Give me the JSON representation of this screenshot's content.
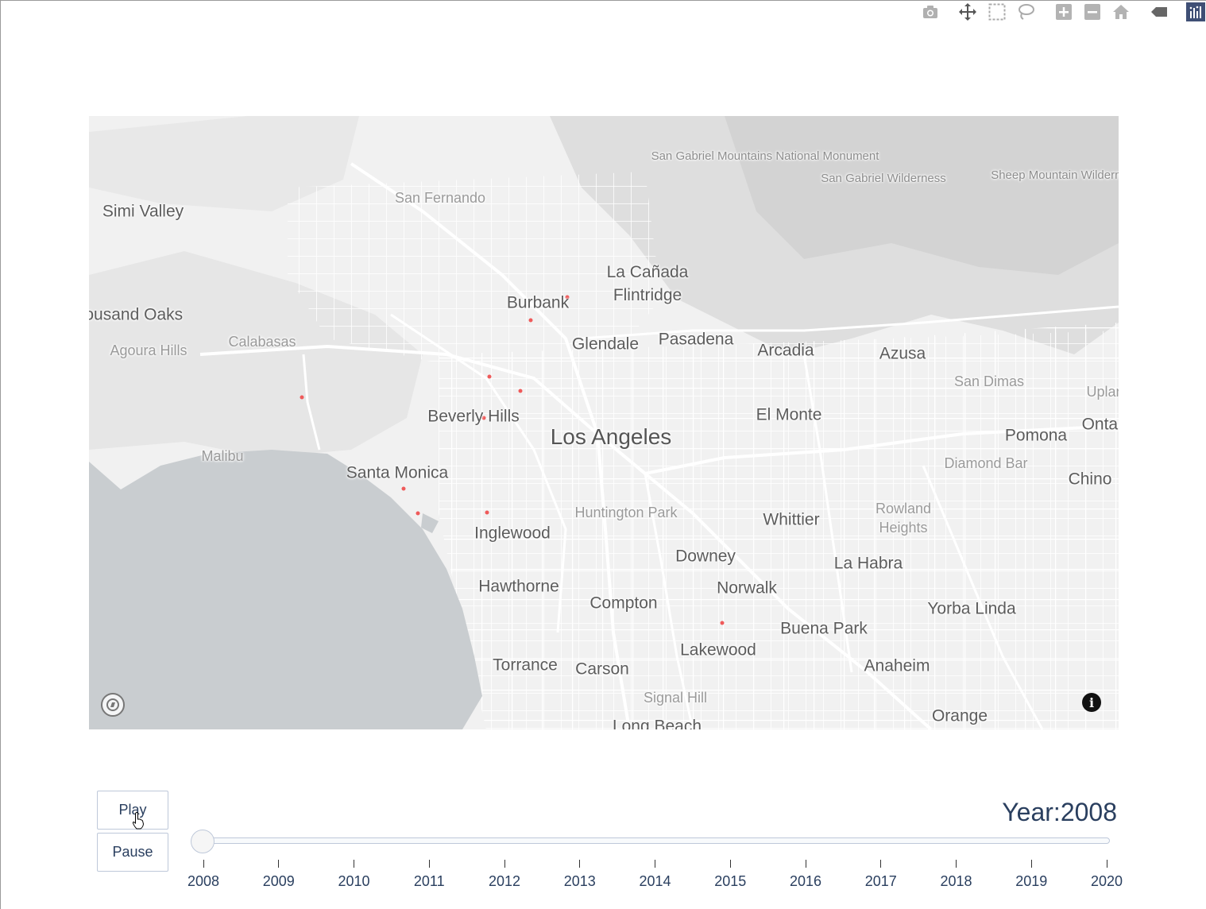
{
  "modebar": {
    "buttons": [
      "camera-icon",
      "pan-icon",
      "box-select-icon",
      "lasso-icon",
      "zoom-in-icon",
      "zoom-out-icon",
      "reset-home-icon",
      "tag-icon",
      "plotly-logo-icon"
    ]
  },
  "map": {
    "cities_large": [
      "Los Angeles"
    ],
    "cities": [
      "Simi Valley",
      "Thousand Oaks",
      "Burbank",
      "La Cañada Flintridge",
      "Glendale",
      "Pasadena",
      "Arcadia",
      "Azusa",
      "Beverly Hills",
      "El Monte",
      "Pomona",
      "Ontario",
      "Chino",
      "Santa Monica",
      "Inglewood",
      "Whittier",
      "Downey",
      "La Habra",
      "Hawthorne",
      "Norwalk",
      "Compton",
      "Yorba Linda",
      "Buena Park",
      "Lakewood",
      "Torrance",
      "Carson",
      "Anaheim",
      "Orange",
      "Long Beach"
    ],
    "minor": [
      "San Fernando",
      "Agoura Hills",
      "Calabasas",
      "San Dimas",
      "Upland",
      "Diamond Bar",
      "Malibu",
      "Huntington Park",
      "Rowland Heights",
      "Signal Hill"
    ],
    "parks": [
      "San Gabriel Mountains National Monument",
      "San Gabriel Wilderness",
      "Sheep Mountain Wilderness"
    ],
    "markers": 10,
    "info_icon": "info-icon",
    "logo_icon": "mapbox-logo-icon"
  },
  "controls": {
    "play_label": "Play",
    "pause_label": "Pause"
  },
  "slider": {
    "prefix": "Year:",
    "current": "2008",
    "steps": [
      "2008",
      "2009",
      "2010",
      "2011",
      "2012",
      "2013",
      "2014",
      "2015",
      "2016",
      "2017",
      "2018",
      "2019",
      "2020"
    ]
  }
}
